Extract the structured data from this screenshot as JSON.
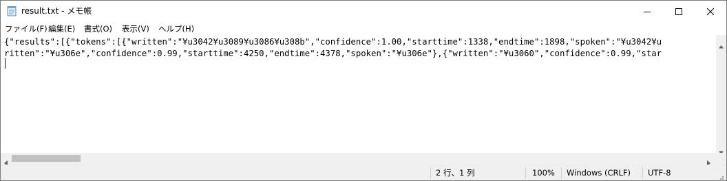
{
  "window": {
    "title": "result.txt - メモ帳",
    "app_icon": "notepad-icon",
    "controls": {
      "minimize": "minimize-icon",
      "maximize": "maximize-icon",
      "close": "close-icon"
    }
  },
  "menu": {
    "items": [
      {
        "label": "ファイル(F)"
      },
      {
        "label": "編集(E)"
      },
      {
        "label": "書式(O)"
      },
      {
        "label": "表示(V)"
      },
      {
        "label": "ヘルプ(H)"
      }
    ]
  },
  "document": {
    "lines": [
      "{\"results\":[{\"tokens\":[{\"written\":\"¥u3042¥u3089¥u3086¥u308b\",\"confidence\":1.00,\"starttime\":1338,\"endtime\":1898,\"spoken\":\"¥u3042¥u",
      "ritten\":\"¥u306e\",\"confidence\":0.99,\"starttime\":4250,\"endtime\":4378,\"spoken\":\"¥u306e\"},{\"written\":\"¥u3060\",\"confidence\":0.99,\"star"
    ]
  },
  "status": {
    "position": "2 行、1 列",
    "zoom": "100%",
    "line_ending": "Windows (CRLF)",
    "encoding": "UTF-8"
  },
  "colors": {
    "statusbar_bg": "#f0f0f0",
    "scroll_thumb": "#c1c1c1",
    "text": "#000000"
  }
}
